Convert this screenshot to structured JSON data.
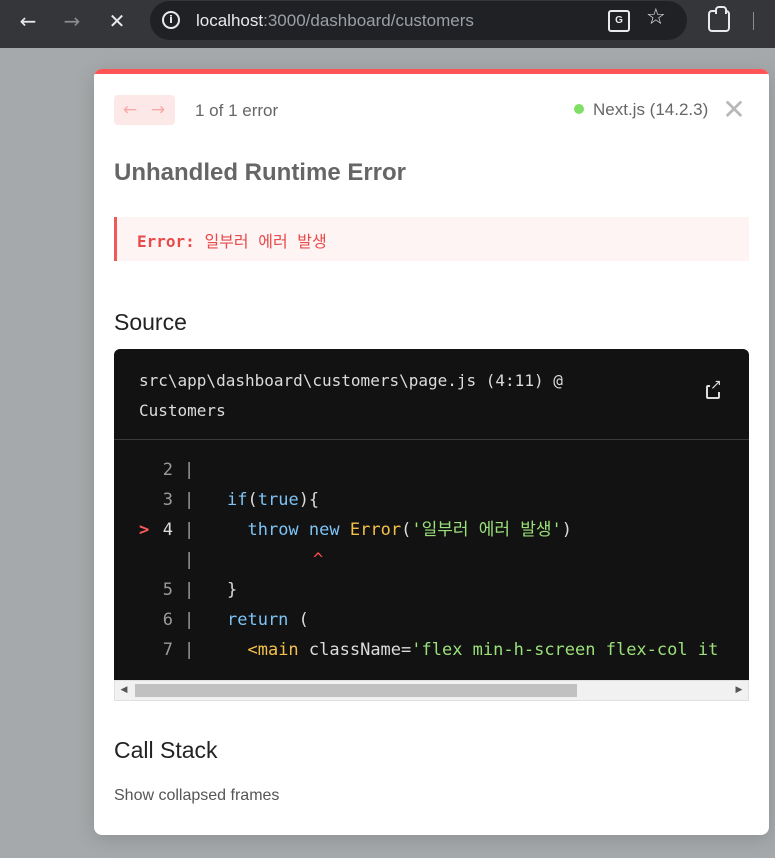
{
  "browser": {
    "back_icon": "←",
    "forward_icon": "→",
    "stop_icon": "✕",
    "url_host": "localhost",
    "url_path": ":3000/dashboard/customers",
    "translate_icon": "G",
    "star_icon": "☆"
  },
  "overlay": {
    "prev_icon": "←",
    "next_icon": "→",
    "error_count": "1 of 1 error",
    "version": "Next.js (14.2.3)",
    "close_icon": "✕",
    "title": "Unhandled Runtime Error",
    "error_label": "Error:",
    "error_message": "일부러 에러 발생",
    "source_heading": "Source",
    "source_file_line1": "src\\app\\dashboard\\customers\\page.js (4:11) @",
    "source_file_line2": "Customers",
    "code": {
      "lines": [
        {
          "num": "2",
          "mark": "",
          "segments": []
        },
        {
          "num": "3",
          "mark": "",
          "segments": [
            {
              "t": "if",
              "c": "kw"
            },
            {
              "t": "(",
              "c": ""
            },
            {
              "t": "true",
              "c": "kw"
            },
            {
              "t": "){",
              "c": ""
            }
          ]
        },
        {
          "num": "4",
          "mark": ">",
          "segments": [
            {
              "t": "  ",
              "c": ""
            },
            {
              "t": "throw",
              "c": "kw"
            },
            {
              "t": " ",
              "c": ""
            },
            {
              "t": "new",
              "c": "kw"
            },
            {
              "t": " ",
              "c": ""
            },
            {
              "t": "Error",
              "c": "fn"
            },
            {
              "t": "(",
              "c": ""
            },
            {
              "t": "'일부러 에러 발생'",
              "c": "str"
            },
            {
              "t": ")",
              "c": ""
            }
          ]
        },
        {
          "num": "",
          "mark": "",
          "caret": "^",
          "segments": []
        },
        {
          "num": "5",
          "mark": "",
          "segments": [
            {
              "t": "}",
              "c": ""
            }
          ]
        },
        {
          "num": "6",
          "mark": "",
          "segments": [
            {
              "t": "return",
              "c": "kw"
            },
            {
              "t": " (",
              "c": ""
            }
          ]
        },
        {
          "num": "7",
          "mark": "",
          "segments": [
            {
              "t": "  ",
              "c": ""
            },
            {
              "t": "<main",
              "c": "tag"
            },
            {
              "t": " className=",
              "c": ""
            },
            {
              "t": "'flex min-h-screen flex-col it",
              "c": "str"
            }
          ]
        }
      ]
    },
    "scroll_left": "◀",
    "scroll_right": "▶",
    "call_stack_heading": "Call Stack",
    "collapsed_frames": "Show collapsed frames"
  }
}
